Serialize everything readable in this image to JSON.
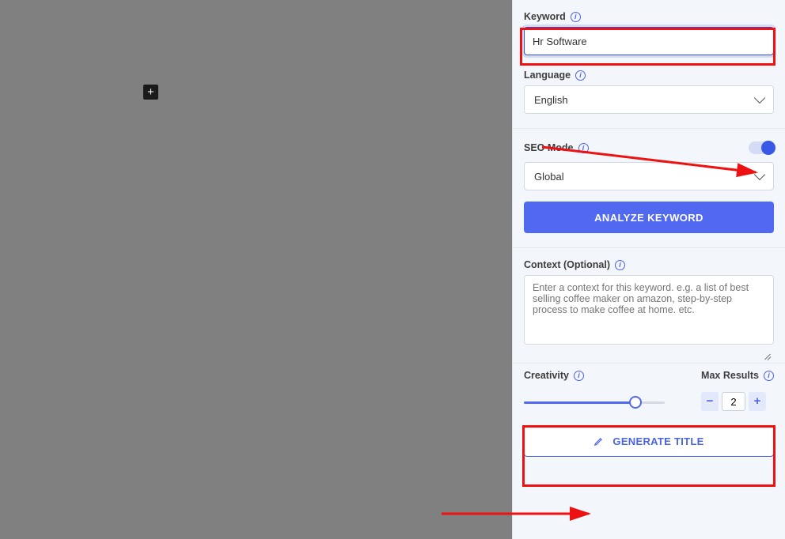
{
  "sidebar": {
    "keyword_label": "Keyword",
    "keyword_value": "Hr Software",
    "language_label": "Language",
    "language_value": "English",
    "seo_mode_label": "SEO Mode",
    "seo_scope_value": "Global",
    "analyze_button": "ANALYZE KEYWORD",
    "context_label": "Context (Optional)",
    "context_placeholder": "Enter a context for this keyword. e.g. a list of best selling coffee maker on amazon, step-by-step process to make coffee at home. etc.",
    "creativity_label": "Creativity",
    "max_results_label": "Max Results",
    "max_results_value": "2",
    "generate_title_button": "GENERATE TITLE"
  },
  "seo_toggle_on": true,
  "creativity_value_pct": 79
}
